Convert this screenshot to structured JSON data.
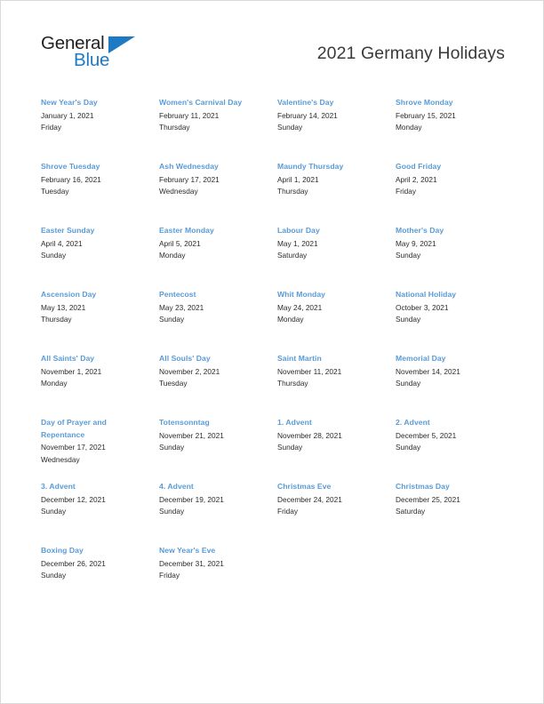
{
  "document": {
    "title": "2021 Germany Holidays",
    "accent_color": "#5b9bd5",
    "logo_blue": "#1f7ac4",
    "text_color": "#2b2b2b"
  },
  "logo": {
    "word_one": "General",
    "word_two": "Blue",
    "mark": "triangle-icon"
  },
  "holidays": [
    [
      {
        "name": "New Year's Day",
        "date": "January 1, 2021",
        "weekday": "Friday"
      },
      {
        "name": "Women's Carnival Day",
        "date": "February 11, 2021",
        "weekday": "Thursday"
      },
      {
        "name": "Valentine's Day",
        "date": "February 14, 2021",
        "weekday": "Sunday"
      },
      {
        "name": "Shrove Monday",
        "date": "February 15, 2021",
        "weekday": "Monday"
      }
    ],
    [
      {
        "name": "Shrove Tuesday",
        "date": "February 16, 2021",
        "weekday": "Tuesday"
      },
      {
        "name": "Ash Wednesday",
        "date": "February 17, 2021",
        "weekday": "Wednesday"
      },
      {
        "name": "Maundy Thursday",
        "date": "April 1, 2021",
        "weekday": "Thursday"
      },
      {
        "name": "Good Friday",
        "date": "April 2, 2021",
        "weekday": "Friday"
      }
    ],
    [
      {
        "name": "Easter Sunday",
        "date": "April 4, 2021",
        "weekday": "Sunday"
      },
      {
        "name": "Easter Monday",
        "date": "April 5, 2021",
        "weekday": "Monday"
      },
      {
        "name": "Labour Day",
        "date": "May 1, 2021",
        "weekday": "Saturday"
      },
      {
        "name": "Mother's Day",
        "date": "May 9, 2021",
        "weekday": "Sunday"
      }
    ],
    [
      {
        "name": "Ascension Day",
        "date": "May 13, 2021",
        "weekday": "Thursday"
      },
      {
        "name": "Pentecost",
        "date": "May 23, 2021",
        "weekday": "Sunday"
      },
      {
        "name": "Whit Monday",
        "date": "May 24, 2021",
        "weekday": "Monday"
      },
      {
        "name": "National Holiday",
        "date": "October 3, 2021",
        "weekday": "Sunday"
      }
    ],
    [
      {
        "name": "All Saints' Day",
        "date": "November 1, 2021",
        "weekday": "Monday"
      },
      {
        "name": "All Souls' Day",
        "date": "November 2, 2021",
        "weekday": "Tuesday"
      },
      {
        "name": "Saint Martin",
        "date": "November 11, 2021",
        "weekday": "Thursday"
      },
      {
        "name": "Memorial Day",
        "date": "November 14, 2021",
        "weekday": "Sunday"
      }
    ],
    [
      {
        "name": "Day of Prayer and Repentance",
        "date": "November 17, 2021",
        "weekday": "Wednesday"
      },
      {
        "name": "Totensonntag",
        "date": "November 21, 2021",
        "weekday": "Sunday"
      },
      {
        "name": "1. Advent",
        "date": "November 28, 2021",
        "weekday": "Sunday"
      },
      {
        "name": "2. Advent",
        "date": "December 5, 2021",
        "weekday": "Sunday"
      }
    ],
    [
      {
        "name": "3. Advent",
        "date": "December 12, 2021",
        "weekday": "Sunday"
      },
      {
        "name": "4. Advent",
        "date": "December 19, 2021",
        "weekday": "Sunday"
      },
      {
        "name": "Christmas Eve",
        "date": "December 24, 2021",
        "weekday": "Friday"
      },
      {
        "name": "Christmas Day",
        "date": "December 25, 2021",
        "weekday": "Saturday"
      }
    ],
    [
      {
        "name": "Boxing Day",
        "date": "December 26, 2021",
        "weekday": "Sunday"
      },
      {
        "name": "New Year's Eve",
        "date": "December 31, 2021",
        "weekday": "Friday"
      },
      {
        "name": "",
        "date": "",
        "weekday": ""
      },
      {
        "name": "",
        "date": "",
        "weekday": ""
      }
    ]
  ]
}
